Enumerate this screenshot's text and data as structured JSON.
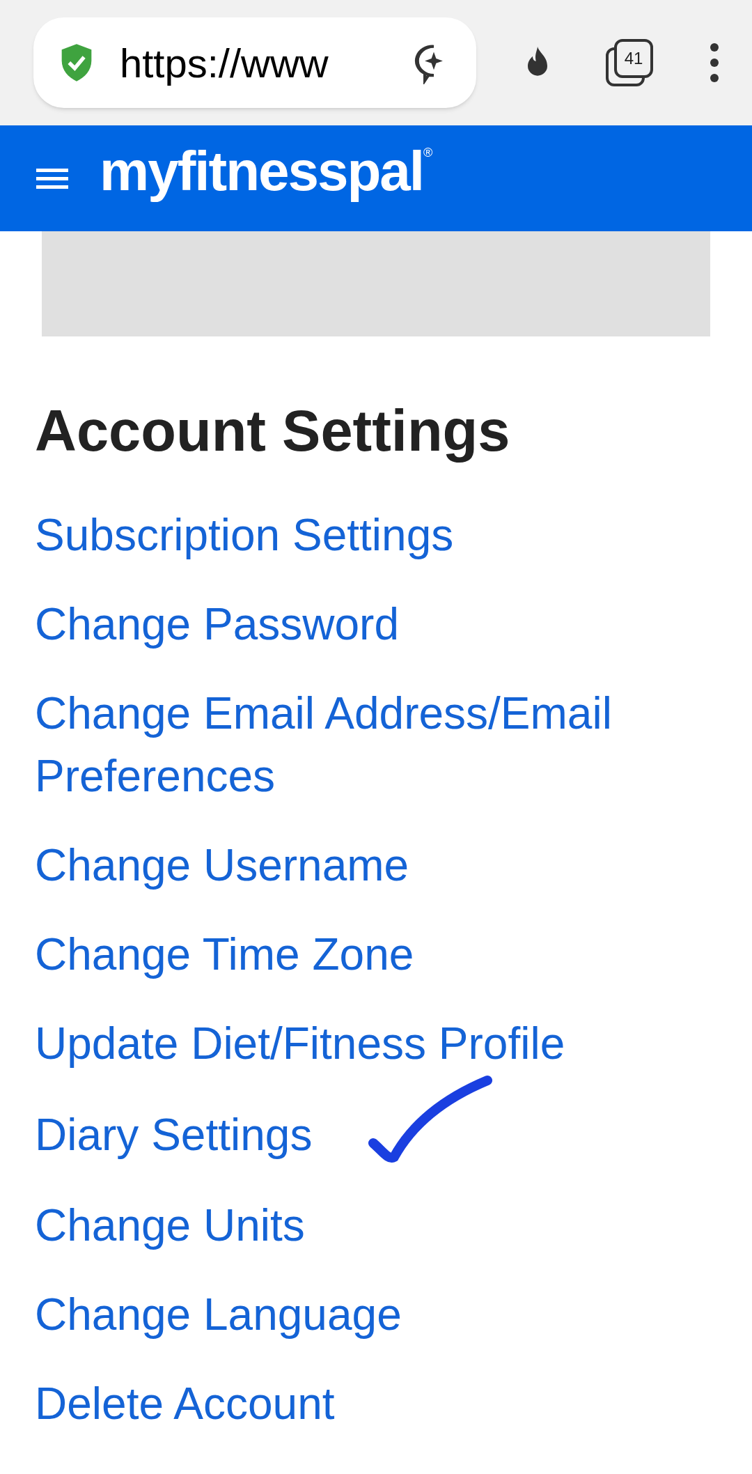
{
  "browser": {
    "url": "https://www",
    "tab_count": "41"
  },
  "header": {
    "logo": "myfitnesspal",
    "logo_mark": "®"
  },
  "ad_banner": {
    "kind": "placeholder"
  },
  "title": "Account Settings",
  "links": [
    {
      "label": "Subscription Settings",
      "checkmarked": false
    },
    {
      "label": "Change Password",
      "checkmarked": false
    },
    {
      "label": "Change Email Address/Email Preferences",
      "checkmarked": false
    },
    {
      "label": "Change Username",
      "checkmarked": false
    },
    {
      "label": "Change Time Zone",
      "checkmarked": false
    },
    {
      "label": "Update Diet/Fitness Profile",
      "checkmarked": false
    },
    {
      "label": "Diary Settings",
      "checkmarked": true
    },
    {
      "label": "Change Units",
      "checkmarked": false
    },
    {
      "label": "Change Language",
      "checkmarked": false
    },
    {
      "label": "Delete Account",
      "checkmarked": false
    }
  ]
}
